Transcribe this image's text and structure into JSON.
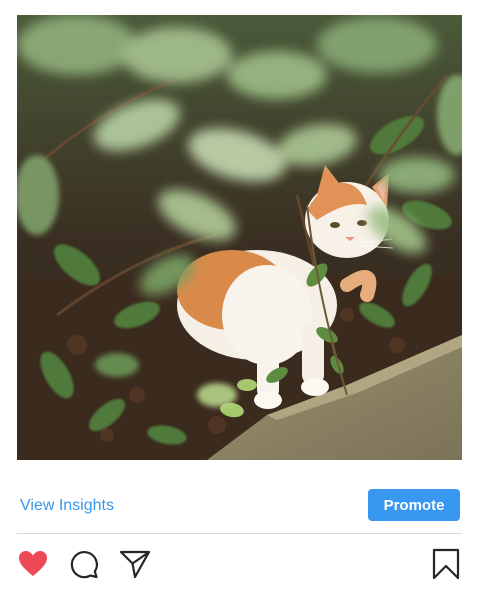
{
  "post": {
    "image_alt": "Orange and white cat crouching among green leaves",
    "liked": true
  },
  "insights": {
    "view_label": "View Insights",
    "promote_label": "Promote"
  },
  "actions": {
    "like_icon": "heart-icon",
    "comment_icon": "comment-icon",
    "share_icon": "paper-plane-icon",
    "save_icon": "bookmark-icon"
  },
  "colors": {
    "accent": "#3897f0",
    "like": "#ed4956",
    "icon": "#262626",
    "divider": "#dbdbdb"
  }
}
